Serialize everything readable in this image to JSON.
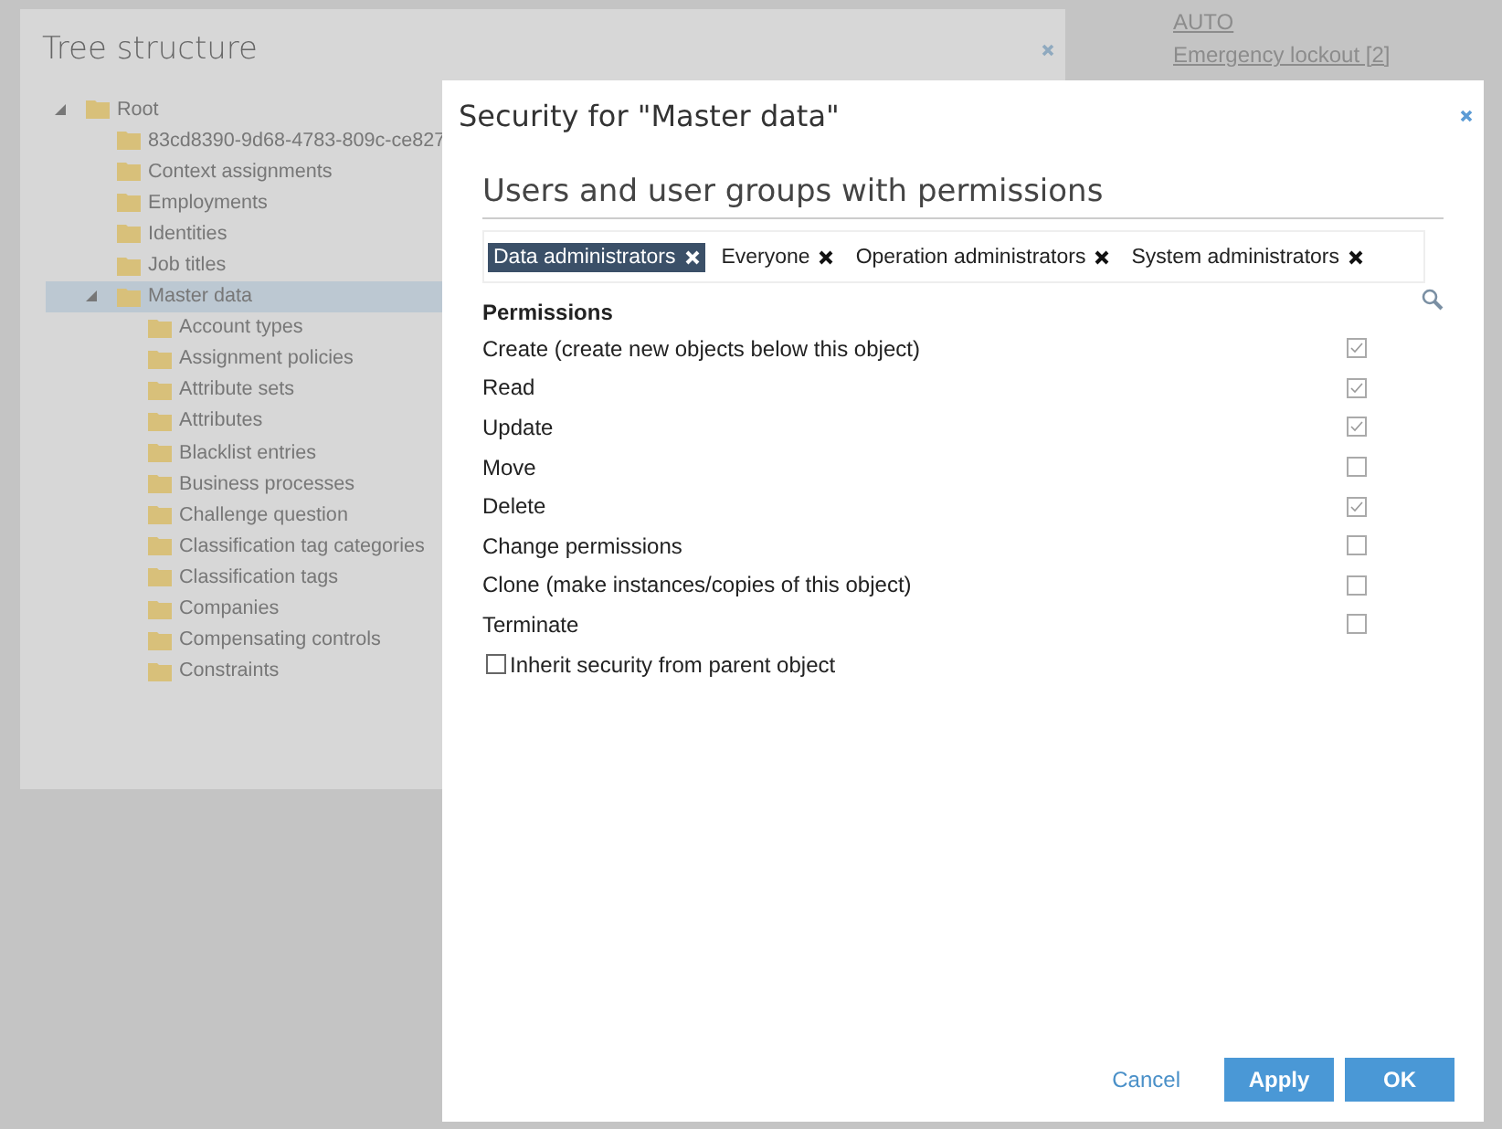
{
  "tree_panel": {
    "title": "Tree structure",
    "tree": [
      {
        "label": "Root",
        "expanded": true,
        "selected": false,
        "children": [
          {
            "label": "83cd8390-9d68-4783-809c-ce827",
            "selected": false
          },
          {
            "label": "Context assignments",
            "selected": false
          },
          {
            "label": "Employments",
            "selected": false
          },
          {
            "label": "Identities",
            "selected": false
          },
          {
            "label": "Job titles",
            "selected": false
          },
          {
            "label": "Master data",
            "expanded": true,
            "selected": true,
            "children": [
              {
                "label": "Account types",
                "selected": false
              },
              {
                "label": "Assignment policies",
                "selected": false
              },
              {
                "label": "Attribute sets",
                "selected": false
              },
              {
                "label": "Attributes",
                "selected": false
              },
              {
                "label": "Blacklist entries",
                "selected": false
              },
              {
                "label": "Business processes",
                "selected": false
              },
              {
                "label": "Challenge question",
                "selected": false
              },
              {
                "label": "Classification tag categories",
                "selected": false
              },
              {
                "label": "Classification tags",
                "selected": false
              },
              {
                "label": "Companies",
                "selected": false
              },
              {
                "label": "Compensating controls",
                "selected": false
              },
              {
                "label": "Constraints",
                "selected": false
              }
            ]
          }
        ]
      }
    ]
  },
  "background_links": [
    "AUTO",
    "Emergency lockout [2]"
  ],
  "dialog": {
    "title": "Security for \"Master data\"",
    "section_heading": "Users and user groups with permissions",
    "groups": [
      {
        "label": "Data administrators",
        "selected": true
      },
      {
        "label": "Everyone",
        "selected": false
      },
      {
        "label": "Operation administrators",
        "selected": false
      },
      {
        "label": "System administrators",
        "selected": false
      }
    ],
    "permissions_heading": "Permissions",
    "permissions": [
      {
        "label": "Create (create new objects below this object)",
        "checked": true
      },
      {
        "label": "Read",
        "checked": true
      },
      {
        "label": "Update",
        "checked": true
      },
      {
        "label": "Move",
        "checked": false
      },
      {
        "label": "Delete",
        "checked": true
      },
      {
        "label": "Change permissions",
        "checked": false
      },
      {
        "label": "Clone (make instances/copies of this object)",
        "checked": false
      },
      {
        "label": "Terminate",
        "checked": false
      }
    ],
    "inherit": {
      "label": "Inherit security from parent object",
      "checked": false
    },
    "buttons": [
      {
        "label": "Cancel",
        "kind": "link"
      },
      {
        "label": "Apply",
        "kind": "primary"
      },
      {
        "label": "OK",
        "kind": "primary"
      }
    ]
  }
}
